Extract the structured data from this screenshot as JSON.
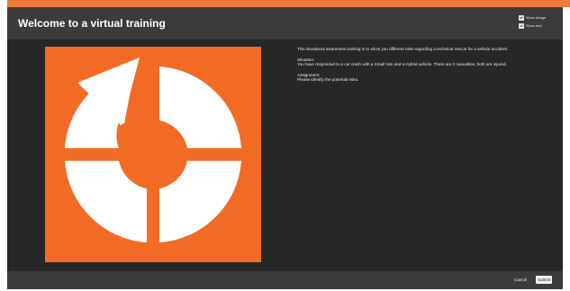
{
  "header": {
    "title": "Welcome to a virtual training",
    "options": [
      {
        "label": "Show image",
        "checked": true
      },
      {
        "label": "Show text",
        "checked": true
      }
    ]
  },
  "hero": {
    "icon": "refresh-cycle-icon",
    "background_color": "#f26b24"
  },
  "content": {
    "intro": "This situational awareness training is to show you different risks regarding a technical rescue for a vehicle accident.",
    "situation_heading": "Situation:",
    "situation_text": "You have responded to a car crash with a Small Van and a Hybrid vehicle. There are 2 casualties, both are injured.",
    "assignment_heading": "Assignment:",
    "assignment_text": "Please identify the potential risks."
  },
  "footer": {
    "cancel_label": "Cancel",
    "submit_label": "Submit"
  },
  "colors": {
    "accent": "#ee7b3a",
    "panel_background": "#272727",
    "bar_background": "#3b3b3b"
  }
}
